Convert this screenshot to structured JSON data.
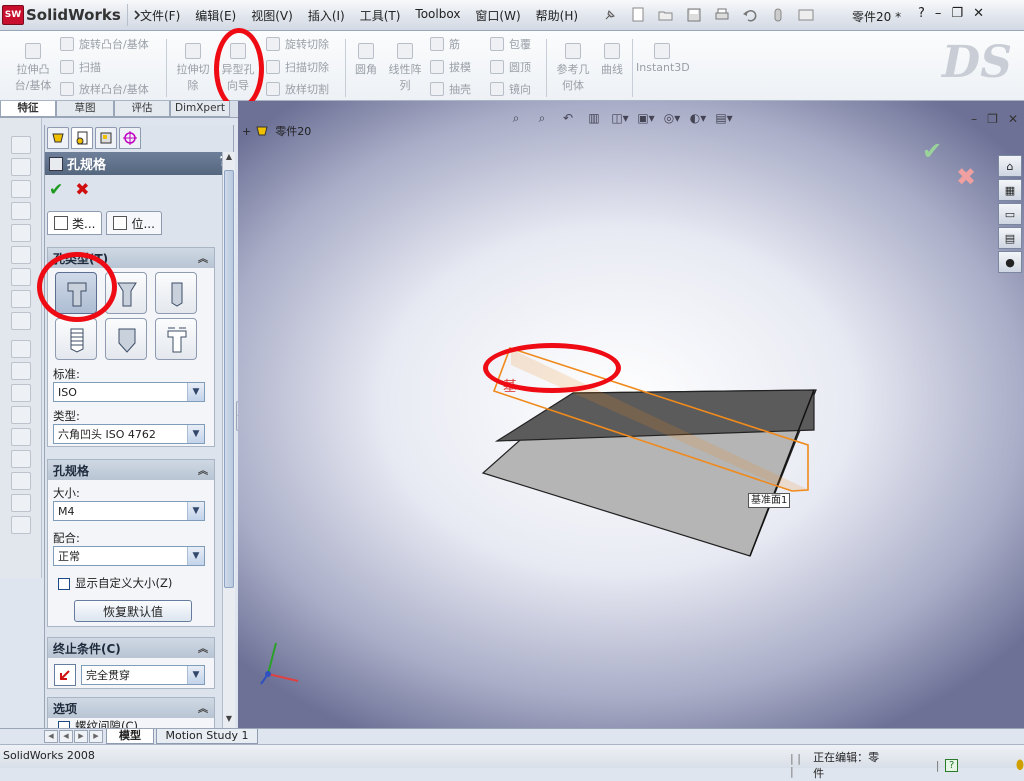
{
  "app": {
    "name": "SolidWorks",
    "doc_title": "零件20 *"
  },
  "menu": [
    "文件(F)",
    "编辑(E)",
    "视图(V)",
    "插入(I)",
    "工具(T)",
    "Toolbox",
    "窗口(W)",
    "帮助(H)"
  ],
  "ribbon": {
    "extrude": "拉伸凸\n台/基体",
    "revolve": "旋转凸台/基体",
    "sweep": "扫描",
    "loft": "放样凸台/基体",
    "extrude_cut": "拉伸切\n除",
    "hole_wizard": "异型孔\n向导",
    "revolve_cut": "旋转切除",
    "sweep_cut": "扫描切除",
    "loft_cut": "放样切割",
    "fillet": "圆角",
    "linear_pattern": "线性阵\n列",
    "rib": "筋",
    "draft": "拔模",
    "shell": "抽壳",
    "wrap": "包覆",
    "dome": "圆顶",
    "mirror": "镜向",
    "ref_geometry": "参考几\n何体",
    "curves": "曲线",
    "instant3d": "Instant3D"
  },
  "cm_tabs": [
    "特征",
    "草图",
    "评估",
    "DimXpert"
  ],
  "property_manager": {
    "title": "孔规格",
    "help": "?",
    "tab_type": "类...",
    "tab_position": "位...",
    "hole_type_group": "孔类型(T)",
    "standard_label": "标准:",
    "standard_value": "ISO",
    "type_label": "类型:",
    "type_value": "六角凹头 ISO 4762",
    "spec_group": "孔规格",
    "size_label": "大小:",
    "size_value": "M4",
    "fit_label": "配合:",
    "fit_value": "正常",
    "custom_size": "显示自定义大小(Z)",
    "restore_defaults": "恢复默认值",
    "end_condition_group": "终止条件(C)",
    "end_condition_value": "完全贯穿",
    "options_group": "选项",
    "options_item": "螺纹间隙(C)"
  },
  "viewport": {
    "tree_root": "零件20",
    "plane_label": "基准面1"
  },
  "bottom_tabs": [
    "模型",
    "Motion Study 1"
  ],
  "status": {
    "left": "SolidWorks 2008",
    "editing": "正在编辑：零件"
  },
  "colors": {
    "accent_red": "#ee0b14",
    "title_bar": "#55677f",
    "plane_outline": "#f08a1c"
  }
}
